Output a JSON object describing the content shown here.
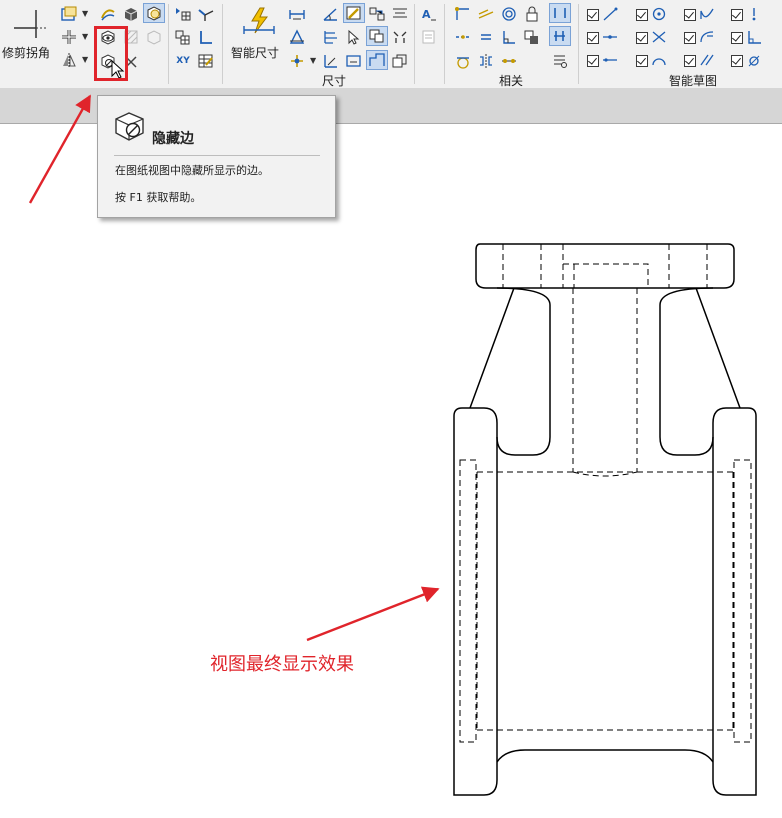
{
  "ribbon": {
    "trim_corner_label": "修剪拐角",
    "smart_dimension_label": "智能尺寸",
    "group_dimension": "尺寸",
    "group_relations": "相关",
    "group_smart_sketch": "智能草图",
    "xy_label": "XY",
    "accent_color": "#1f5fb4",
    "highlight_color": "#e0242b"
  },
  "tooltip": {
    "icon": "hide-edges-icon",
    "title": "隐藏边",
    "description": "在图纸视图中隐藏所显示的边。",
    "help": "按 F1 获取帮助。"
  },
  "annotation": {
    "caption": "视图最终显示效果"
  }
}
